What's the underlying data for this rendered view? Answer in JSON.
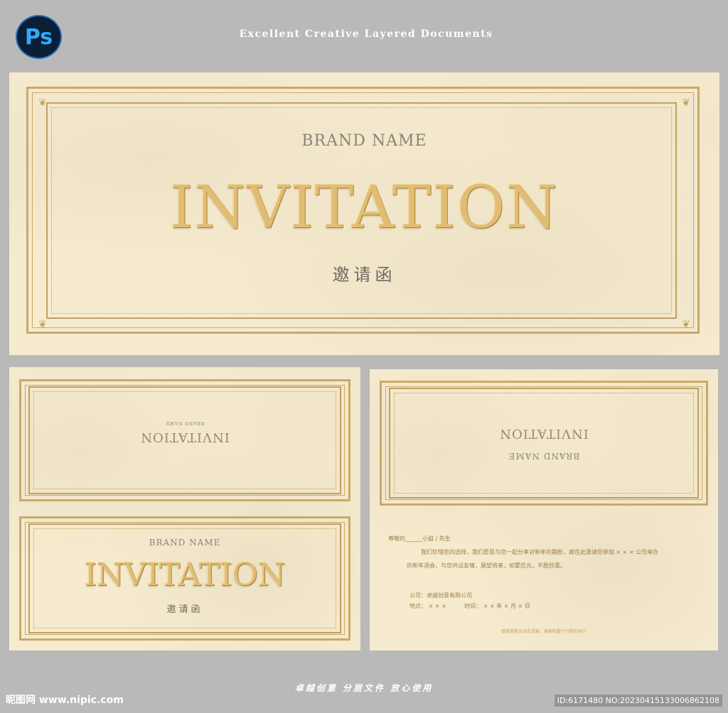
{
  "header": {
    "app_badge": "Ps",
    "banner": "Excellent Creative Layered Documents"
  },
  "card_main": {
    "brand": "BRAND NAME",
    "title": "INVITATION",
    "subtitle": "邀请函"
  },
  "card_left_top": {
    "title": "INVITATION",
    "brand": "BRAND NAME"
  },
  "card_left_bottom": {
    "brand": "BRAND NAME",
    "title": "INVITATION",
    "subtitle": "邀请函"
  },
  "card_right_top": {
    "title": "INVITATION",
    "brand": "BRAND NAME"
  },
  "letter": {
    "salutation": "尊敬的______小姐 / 先生",
    "line1": "我们珍惜您的选择，我们愿意与您一起分享对新年的期盼，故在此邀请您参加 × × × 公司举办",
    "line2": "的新年酒会，与您共话友情，展望将来，如蒙应允，不胜欣喜。",
    "company": "公司：卓越创意有限公司",
    "place_time": "地点： × × ×          时间： × × 年 × 月 × 日",
    "footer": "请随邀者出示此请柬，谢谢和整个行程的时计"
  },
  "footer": {
    "slogan": "卓越创意  分层文件  放心使用",
    "site": "昵图网 www.nipic.com",
    "id_line": "ID:6171480 NO:20230415133006862108"
  },
  "colors": {
    "background": "#b9b9b9",
    "card": "#f7ebcf",
    "gold": "#e1bd73",
    "frame": "#c8aa6a"
  }
}
